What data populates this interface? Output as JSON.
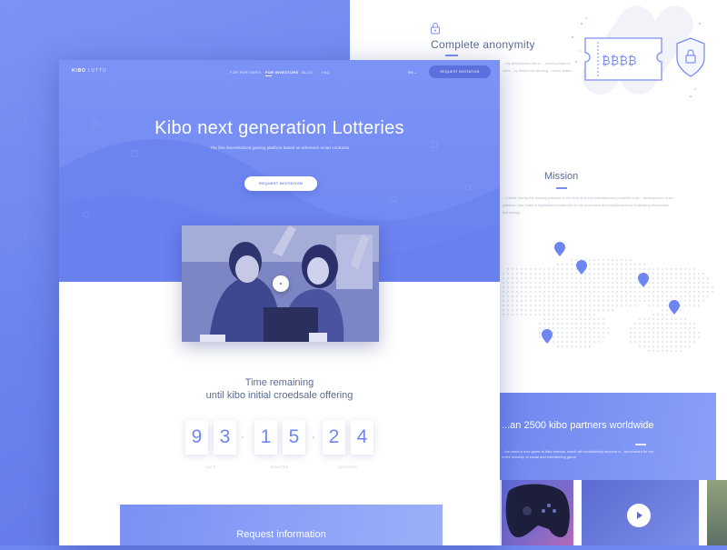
{
  "colors": {
    "accent": "#6e86f2",
    "accent_dark": "#5b70dd",
    "text_dark": "#5d6b94",
    "text_light": "#c2c7d6"
  },
  "back_page": {
    "anonymity": {
      "icon": "lock-icon",
      "title": "Complete anonymity",
      "text": "...ely anonymous due to ...urrency base of work ...cy keeps the winning ...rency wallet"
    },
    "ticket": {
      "icon": "ticket-shield-icon",
      "symbols": "₿₿₿₿"
    },
    "mission": {
      "title": "Mission",
      "text": "...d build one by the leading platform in the field of social entertainment powerful cryp... development of the platform, can make a significant contribution to the promotion and cryptocurrency underlying blockchain technology"
    },
    "map": {
      "icon": "world-dot-map",
      "pins": 5
    },
    "partners": {
      "title": "...an 2500 kibo partners worldwide",
      "text": "...the world a new game of kibo formats, which will undoubtedly become a ...benchmark for the entire industry of social and entertaining game."
    },
    "tiles": [
      "gamepad-image",
      "video-image",
      "street-image"
    ]
  },
  "header": {
    "brand_bold": "KIBO",
    "brand_thin": "LOTTO",
    "nav": [
      "FOR PARTNERS",
      "FOR INVESTORS",
      "BLOG",
      "FAQ"
    ],
    "active_nav": "FOR INVESTORS",
    "language": "EN",
    "cta": "REQUEST INVITATION"
  },
  "hero": {
    "title": "Kibo next generation Lotteries",
    "subtitle": "The first decentralized gaming platform based on ethereum smart contracts",
    "button": "REQUEST INVITATION"
  },
  "video": {
    "icon": "play-icon"
  },
  "countdown": {
    "title_line1": "Time remaining",
    "title_line2": "until kibo initial croedsale offering",
    "digits": [
      "9",
      "3",
      "1",
      "5",
      "2",
      "4"
    ],
    "labels": [
      "DAYS",
      "MINUTES",
      "SECONDS"
    ]
  },
  "request": {
    "title": "Request information"
  }
}
